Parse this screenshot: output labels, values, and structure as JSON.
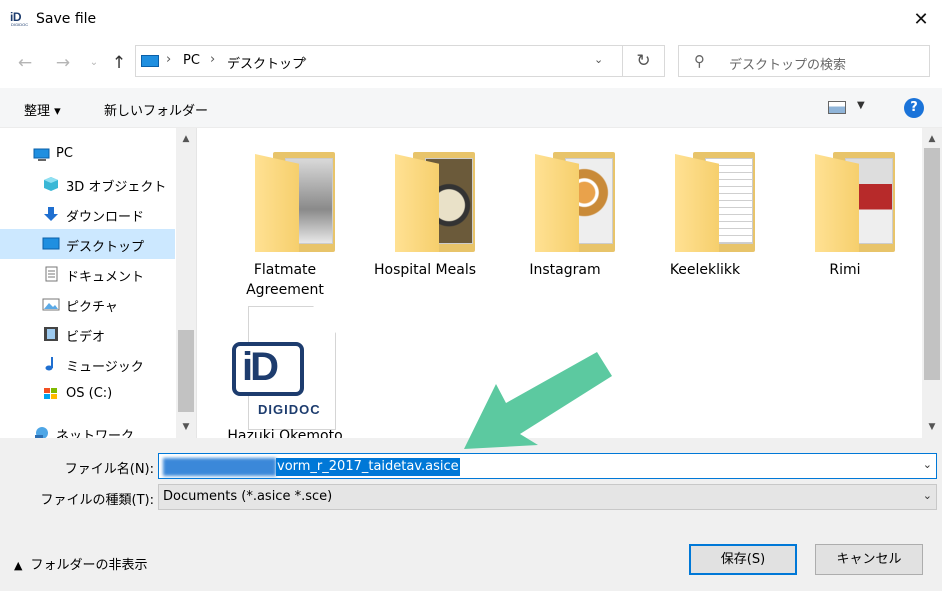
{
  "window": {
    "title": "Save file",
    "logo_text": "iD",
    "logo_subtext": "DIGIDOC"
  },
  "nav": {
    "back_icon": "back-arrow-icon",
    "forward_icon": "forward-arrow-icon",
    "recent_icon": "chevron-down-icon",
    "up_icon": "up-arrow-icon",
    "breadcrumb": [
      "PC",
      "デスクトップ"
    ],
    "search_placeholder": "デスクトップの検索"
  },
  "toolbar": {
    "organize_label": "整理 ▾",
    "new_folder_label": "新しいフォルダー"
  },
  "sidebar": {
    "items": [
      {
        "label": "PC",
        "icon": "pc-icon"
      },
      {
        "label": "3D オブジェクト",
        "icon": "cube-icon"
      },
      {
        "label": "ダウンロード",
        "icon": "download-icon"
      },
      {
        "label": "デスクトップ",
        "icon": "desktop-icon",
        "selected": true
      },
      {
        "label": "ドキュメント",
        "icon": "document-icon"
      },
      {
        "label": "ピクチャ",
        "icon": "picture-icon"
      },
      {
        "label": "ビデオ",
        "icon": "video-icon"
      },
      {
        "label": "ミュージック",
        "icon": "music-icon"
      },
      {
        "label": "OS (C:)",
        "icon": "drive-icon"
      },
      {
        "label": "ネットワーク",
        "icon": "network-icon"
      }
    ]
  },
  "files": [
    {
      "label": "Flatmate Agreement",
      "type": "folder"
    },
    {
      "label": "Hospital Meals",
      "type": "folder"
    },
    {
      "label": "Instagram",
      "type": "folder"
    },
    {
      "label": "Keeleklikk",
      "type": "folder"
    },
    {
      "label": "Rimi",
      "type": "folder"
    },
    {
      "label": "Hazuki Okemoto",
      "type": "digidoc-file",
      "badge": "iD",
      "word": "DIGIDOC"
    }
  ],
  "form": {
    "filename_label": "ファイル名(N):",
    "filename_value": "vorm_r_2017_taidetav.asice",
    "filetype_label": "ファイルの種類(T):",
    "filetype_value": "Documents (*.asice *.sce)",
    "hide_folders_label": "フォルダーの非表示",
    "save_label": "保存(S)",
    "cancel_label": "キャンセル"
  },
  "colors": {
    "accent": "#0078d7",
    "annotation_arrow": "#5cc9a0",
    "selected_bg": "#cce8ff"
  }
}
